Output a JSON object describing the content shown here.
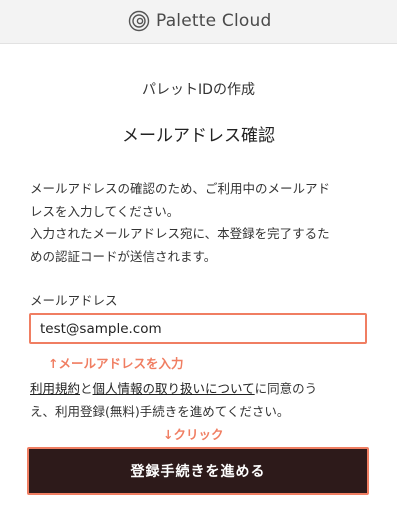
{
  "header": {
    "logo_text": "Palette Cloud",
    "logo_icon": "palette-cloud-logo-icon"
  },
  "page": {
    "subtitle": "パレットIDの作成",
    "title": "メールアドレス確認",
    "description_lines": [
      "メールアドレスの確認のため、ご利用中のメールアド",
      "レスを入力してください。",
      "入力されたメールアドレス宛に、本登録を完了するた",
      "めの認証コードが送信されます。"
    ]
  },
  "form": {
    "email_label": "メールアドレス",
    "email_value": "test@sample.com",
    "email_annotation": "↑メールアドレスを入力",
    "consent": {
      "link_terms": "利用規約",
      "text_and": "と",
      "link_privacy": "個人情報の取り扱いについて",
      "text_rest_line1": "に同意のう",
      "text_line2": "え、利用登録(無料)手続きを進めてください。"
    },
    "click_annotation": "↓クリック",
    "submit_label": "登録手続きを進める"
  },
  "colors": {
    "accent": "#f07e62",
    "button_bg": "#2d1a1a",
    "header_bg": "#f3f3f3"
  }
}
